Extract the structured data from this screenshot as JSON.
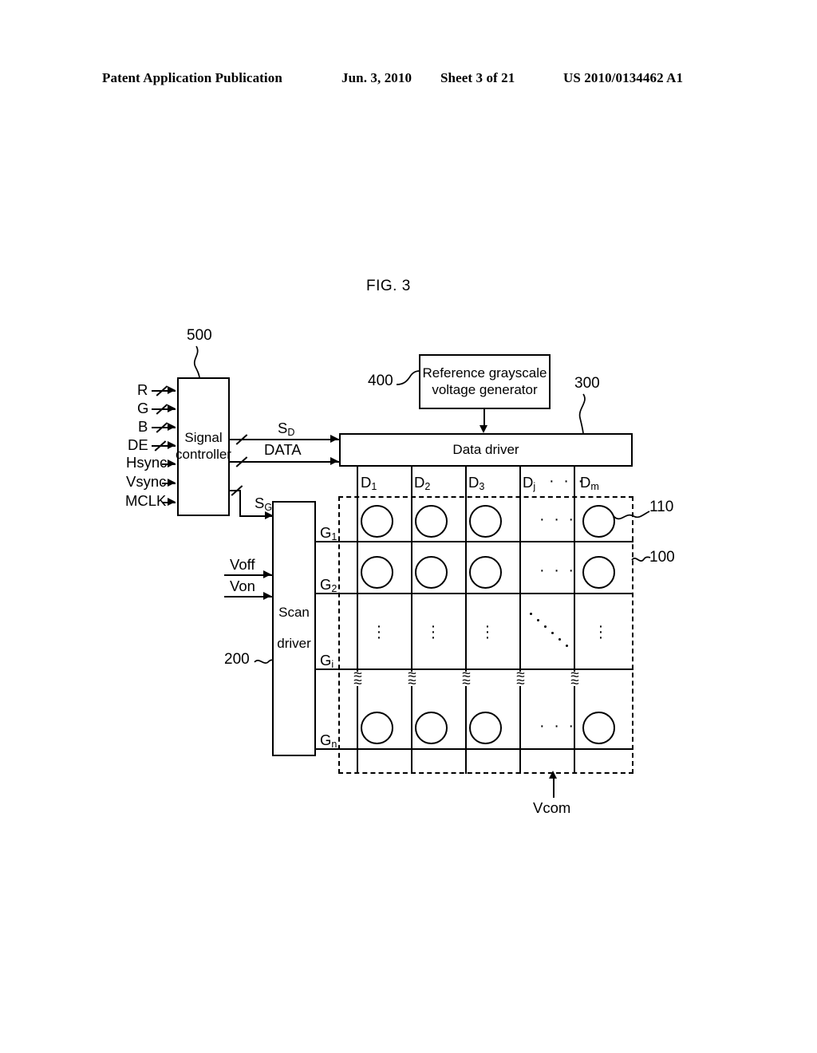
{
  "header": {
    "publication": "Patent Application Publication",
    "date": "Jun. 3, 2010",
    "sheet": "Sheet 3 of 21",
    "number": "US 2010/0134462 A1"
  },
  "figure": {
    "title": "FIG. 3"
  },
  "blocks": {
    "signal_controller": {
      "line1": "Signal",
      "line2": "controller",
      "ref": "500"
    },
    "reference_generator": {
      "line1": "Reference grayscale",
      "line2": "voltage generator",
      "ref": "400"
    },
    "data_driver": {
      "label": "Data driver",
      "ref": "300"
    },
    "scan_driver": {
      "line1": "Scan",
      "line2": "driver",
      "ref": "200"
    },
    "panel": {
      "ref": "100"
    },
    "pixel": {
      "ref": "110"
    }
  },
  "inputs": {
    "bus_signals": [
      "R",
      "G",
      "B",
      "DE"
    ],
    "single_signals": [
      "Hsync",
      "Vsync",
      "MCLK"
    ]
  },
  "controller_outputs": {
    "sd": "S",
    "sd_sub": "D",
    "data": "DATA",
    "sg": "S",
    "sg_sub": "G"
  },
  "scan_driver_inputs": [
    "Voff",
    "Von"
  ],
  "common_voltage": "Vcom",
  "data_lines": [
    {
      "base": "D",
      "sub": "1"
    },
    {
      "base": "D",
      "sub": "2"
    },
    {
      "base": "D",
      "sub": "3"
    },
    {
      "base": "D",
      "sub": "j"
    },
    {
      "base": "D",
      "sub": "m"
    }
  ],
  "data_line_ellipsis": "· · ·",
  "gate_lines": [
    {
      "base": "G",
      "sub": "1"
    },
    {
      "base": "G",
      "sub": "2"
    },
    {
      "base": "G",
      "sub": "i"
    },
    {
      "base": "G",
      "sub": "n"
    }
  ],
  "row_ellipsis": "· · ·",
  "column_ellipsis_dot": "·",
  "break_mark": "≈"
}
